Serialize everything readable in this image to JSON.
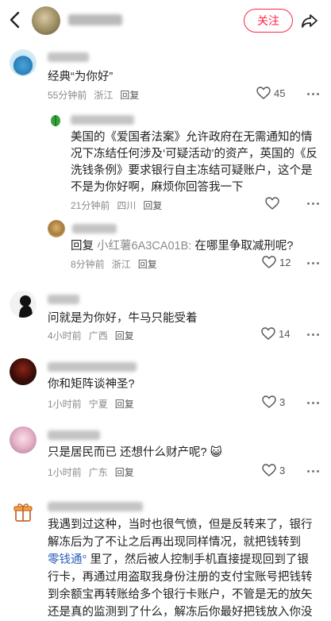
{
  "header": {
    "follow_label": "关注",
    "icons": [
      "chevron-left-icon",
      "share-icon"
    ]
  },
  "comments": [
    {
      "text": "经典“为你好”",
      "time": "55分钟前",
      "location": "浙江",
      "reply_label": "回复",
      "likes": "45"
    },
    {
      "text": "美国的《爱国者法案》允许政府在无需通知的情况下冻结任何涉及‘可疑活动’的资产，英国的《反洗钱条例》要求银行自主冻结可疑账户，这个是不是为你好啊，麻烦你回答我一下",
      "time": "21分钟前",
      "location": "四川",
      "reply_label": "回复",
      "likes": ""
    },
    {
      "reply_prefix": "回复",
      "reply_target": "小红薯6A3CA01B:",
      "text": " 在哪里争取减刑呢?",
      "time": "8分钟前",
      "location": "浙江",
      "reply_label": "回复",
      "likes": "12"
    },
    {
      "text": "问就是为你好，牛马只能受着",
      "time": "4小时前",
      "location": "广西",
      "reply_label": "回复",
      "likes": "14"
    },
    {
      "text": "你和矩阵谈神圣?",
      "time": "1小时前",
      "location": "宁夏",
      "reply_label": "回复",
      "likes": "3"
    },
    {
      "text": "只是居民而已 还想什么财产呢?",
      "emoji": "😺",
      "time": "1小时前",
      "location": "广东",
      "reply_label": "回复",
      "likes": "3"
    },
    {
      "text_before": "我遇到过这种，当时也很气愤，但是反转来了，银行解冻后为了不让之后再出现同样情况，就把钱转到",
      "link": "零钱通",
      "text_after": "里了，然后被人控制手机直接提现回到了银行卡，再通过用盗取我身份注册的支付宝账号把钱转到余额宝再转账给多个银行卡账户，不管是无的放矢还是真的监测到了什么，解冻后你最好把钱放入你没有绑定任何支付系统的卡里。"
    }
  ]
}
